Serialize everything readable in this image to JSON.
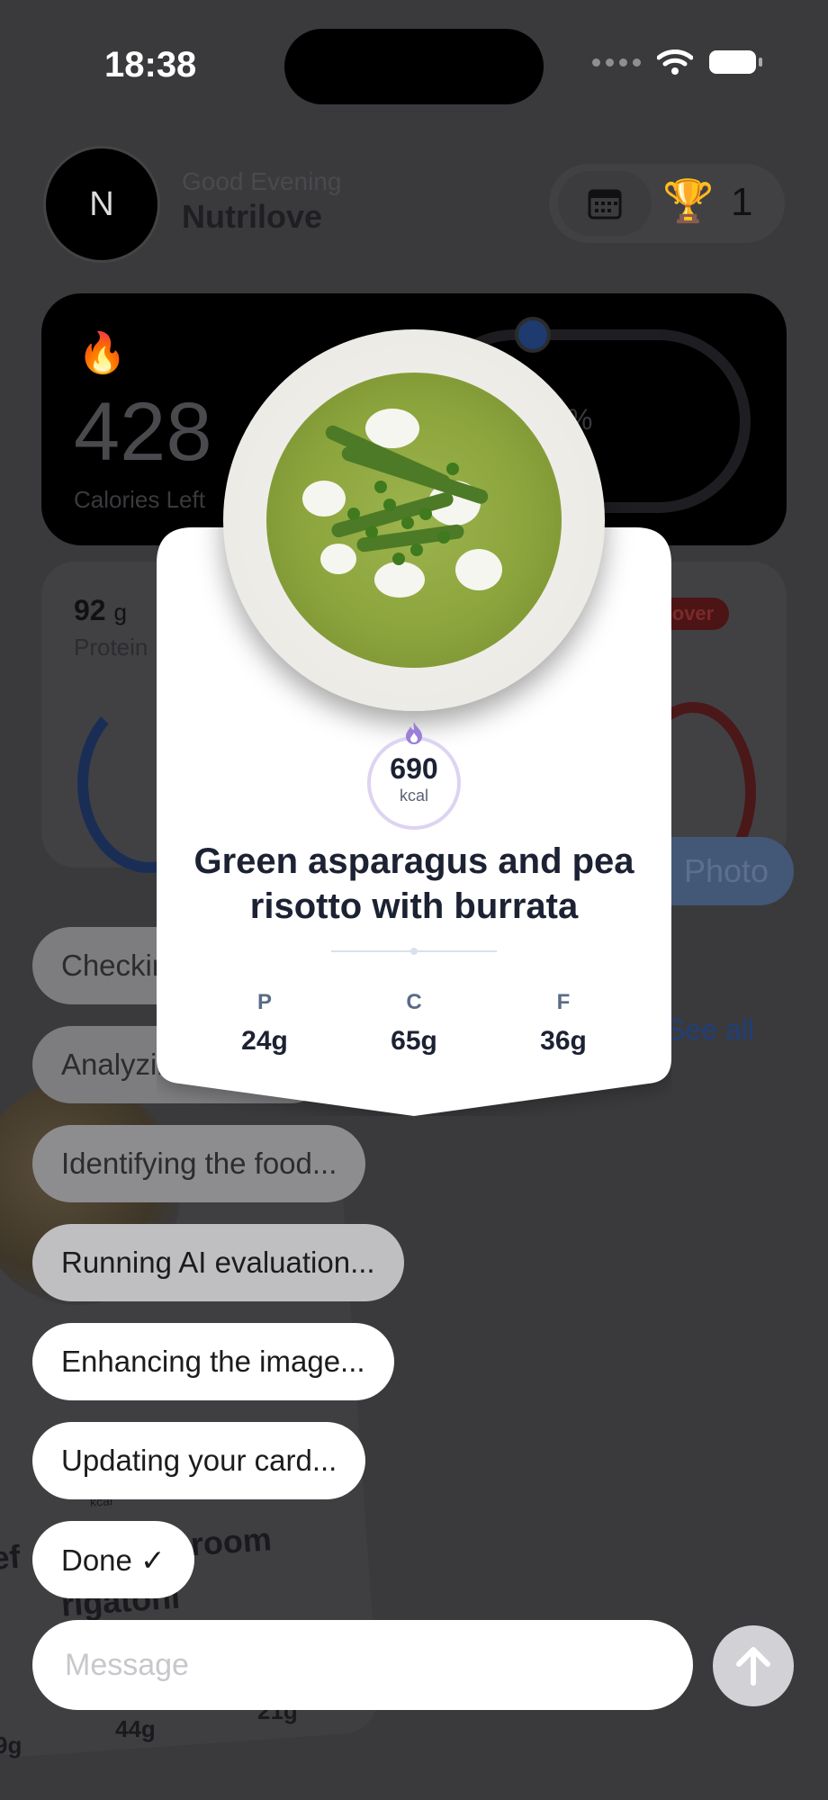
{
  "status_bar": {
    "time": "18:38"
  },
  "header": {
    "avatar_initial": "N",
    "greeting": "Good Evening",
    "username": "Nutrilove",
    "streak_count": "1"
  },
  "calorie_card": {
    "calories_left": "428",
    "label": "Calories Left",
    "percent_suffix": "%"
  },
  "macros_card": {
    "protein_value": "92",
    "protein_unit": "g",
    "protein_label": "Protein",
    "over_badge": "over",
    "photo_button": "Photo"
  },
  "see_all": "See all",
  "background_food_card": {
    "kcal_label": "kcal",
    "title_line1": "ef",
    "title_line1b": "room",
    "title_line2": "rigatoni",
    "macro_values": [
      "9g",
      "44g",
      "21g"
    ]
  },
  "progress_steps": [
    "Checking...",
    "Analyzing...",
    "Identifying the food...",
    "Running AI evaluation...",
    "Enhancing the image...",
    "Updating your card...",
    "Done ✓"
  ],
  "message_bar": {
    "placeholder": "Message"
  },
  "food_result": {
    "kcal_value": "690",
    "kcal_unit": "kcal",
    "title": "Green asparagus and pea risotto with burrata",
    "macros": [
      {
        "key": "P",
        "value": "24g"
      },
      {
        "key": "C",
        "value": "65g"
      },
      {
        "key": "F",
        "value": "36g"
      }
    ]
  },
  "colors": {
    "overlay_bg": "#3a3a3c",
    "card_bg": "#ffffff",
    "text_dark": "#1c2233",
    "kcal_accent": "#9b7fd8",
    "send_button": "#d1d1d6"
  },
  "icons": [
    "wifi-icon",
    "battery-icon",
    "calendar-icon",
    "trophy-icon",
    "flame-icon",
    "send-arrow-icon"
  ]
}
